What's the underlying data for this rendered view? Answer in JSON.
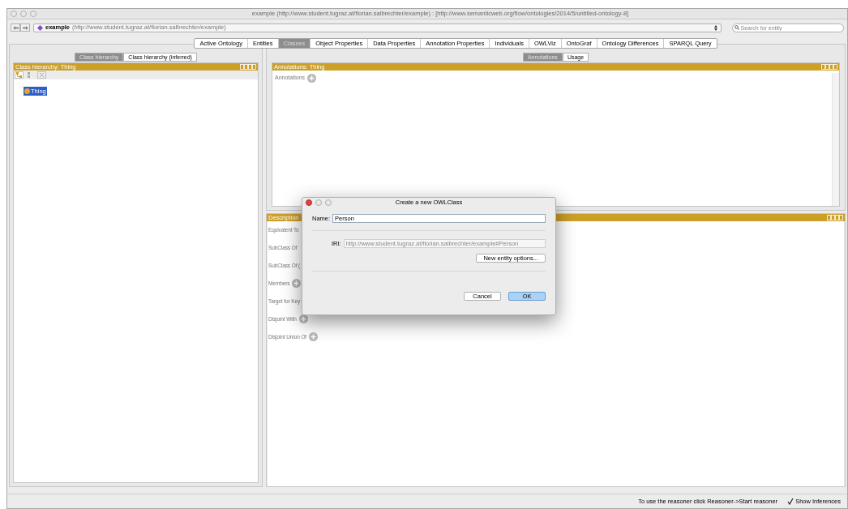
{
  "window": {
    "title": "example (http://www.student.tugraz.at/florian.salbrechter/example)  : [http://www.semanticweb.org/flow/ontologies/2014/5/untitled-ontology-8]"
  },
  "toolbar": {
    "ontology_name": "example",
    "ontology_iri": "(http://www.student.tugraz.at/florian.salbrechter/example)",
    "search": {
      "placeholder": "Search for entity"
    }
  },
  "tabs": [
    {
      "label": "Active Ontology",
      "selected": false
    },
    {
      "label": "Entities",
      "selected": false
    },
    {
      "label": "Classes",
      "selected": true
    },
    {
      "label": "Object Properties",
      "selected": false
    },
    {
      "label": "Data Properties",
      "selected": false
    },
    {
      "label": "Annotation Properties",
      "selected": false
    },
    {
      "label": "Individuals",
      "selected": false
    },
    {
      "label": "OWLViz",
      "selected": false
    },
    {
      "label": "OntoGraf",
      "selected": false
    },
    {
      "label": "Ontology Differences",
      "selected": false
    },
    {
      "label": "SPARQL Query",
      "selected": false
    }
  ],
  "left_panel": {
    "tabs": [
      {
        "label": "Class hierarchy",
        "selected": true
      },
      {
        "label": "Class hierarchy (inferred)",
        "selected": false
      }
    ],
    "header": "Class hierarchy: Thing",
    "tree": [
      {
        "label": "Thing",
        "selected": true
      }
    ]
  },
  "annotations_panel": {
    "tabs": [
      {
        "label": "Annotations",
        "selected": true
      },
      {
        "label": "Usage",
        "selected": false
      }
    ],
    "header": "Annotations: Thing",
    "sections": [
      {
        "label": "Annotations",
        "add_button": true
      }
    ]
  },
  "description_panel": {
    "header": "Description",
    "sections": [
      {
        "label": "Equivalent To",
        "add_button": false
      },
      {
        "label": "SubClass Of",
        "add_button": false
      },
      {
        "label": "SubClass Of (",
        "add_button": false
      },
      {
        "label": "Members",
        "add_button": true
      },
      {
        "label": "Target for Key",
        "add_button": false
      },
      {
        "label": "Disjoint With",
        "add_button": true
      },
      {
        "label": "Disjoint Union Of",
        "add_button": true
      }
    ]
  },
  "dialog": {
    "title": "Create a new OWLClass",
    "name_label": "Name:",
    "name_value": "Person",
    "iri_label": "IRI:",
    "iri_value": "http://www.student.tugraz.at/florian.salbrechter/example#Person",
    "options_button": "New entity options...",
    "buttons": [
      {
        "label": "Cancel",
        "default": false
      },
      {
        "label": "OK",
        "default": true
      }
    ]
  },
  "status_bar": {
    "message": "To use the reasoner click Reasoner->Start reasoner",
    "show_inferences": {
      "label": "Show Inferences",
      "checked": true
    }
  }
}
